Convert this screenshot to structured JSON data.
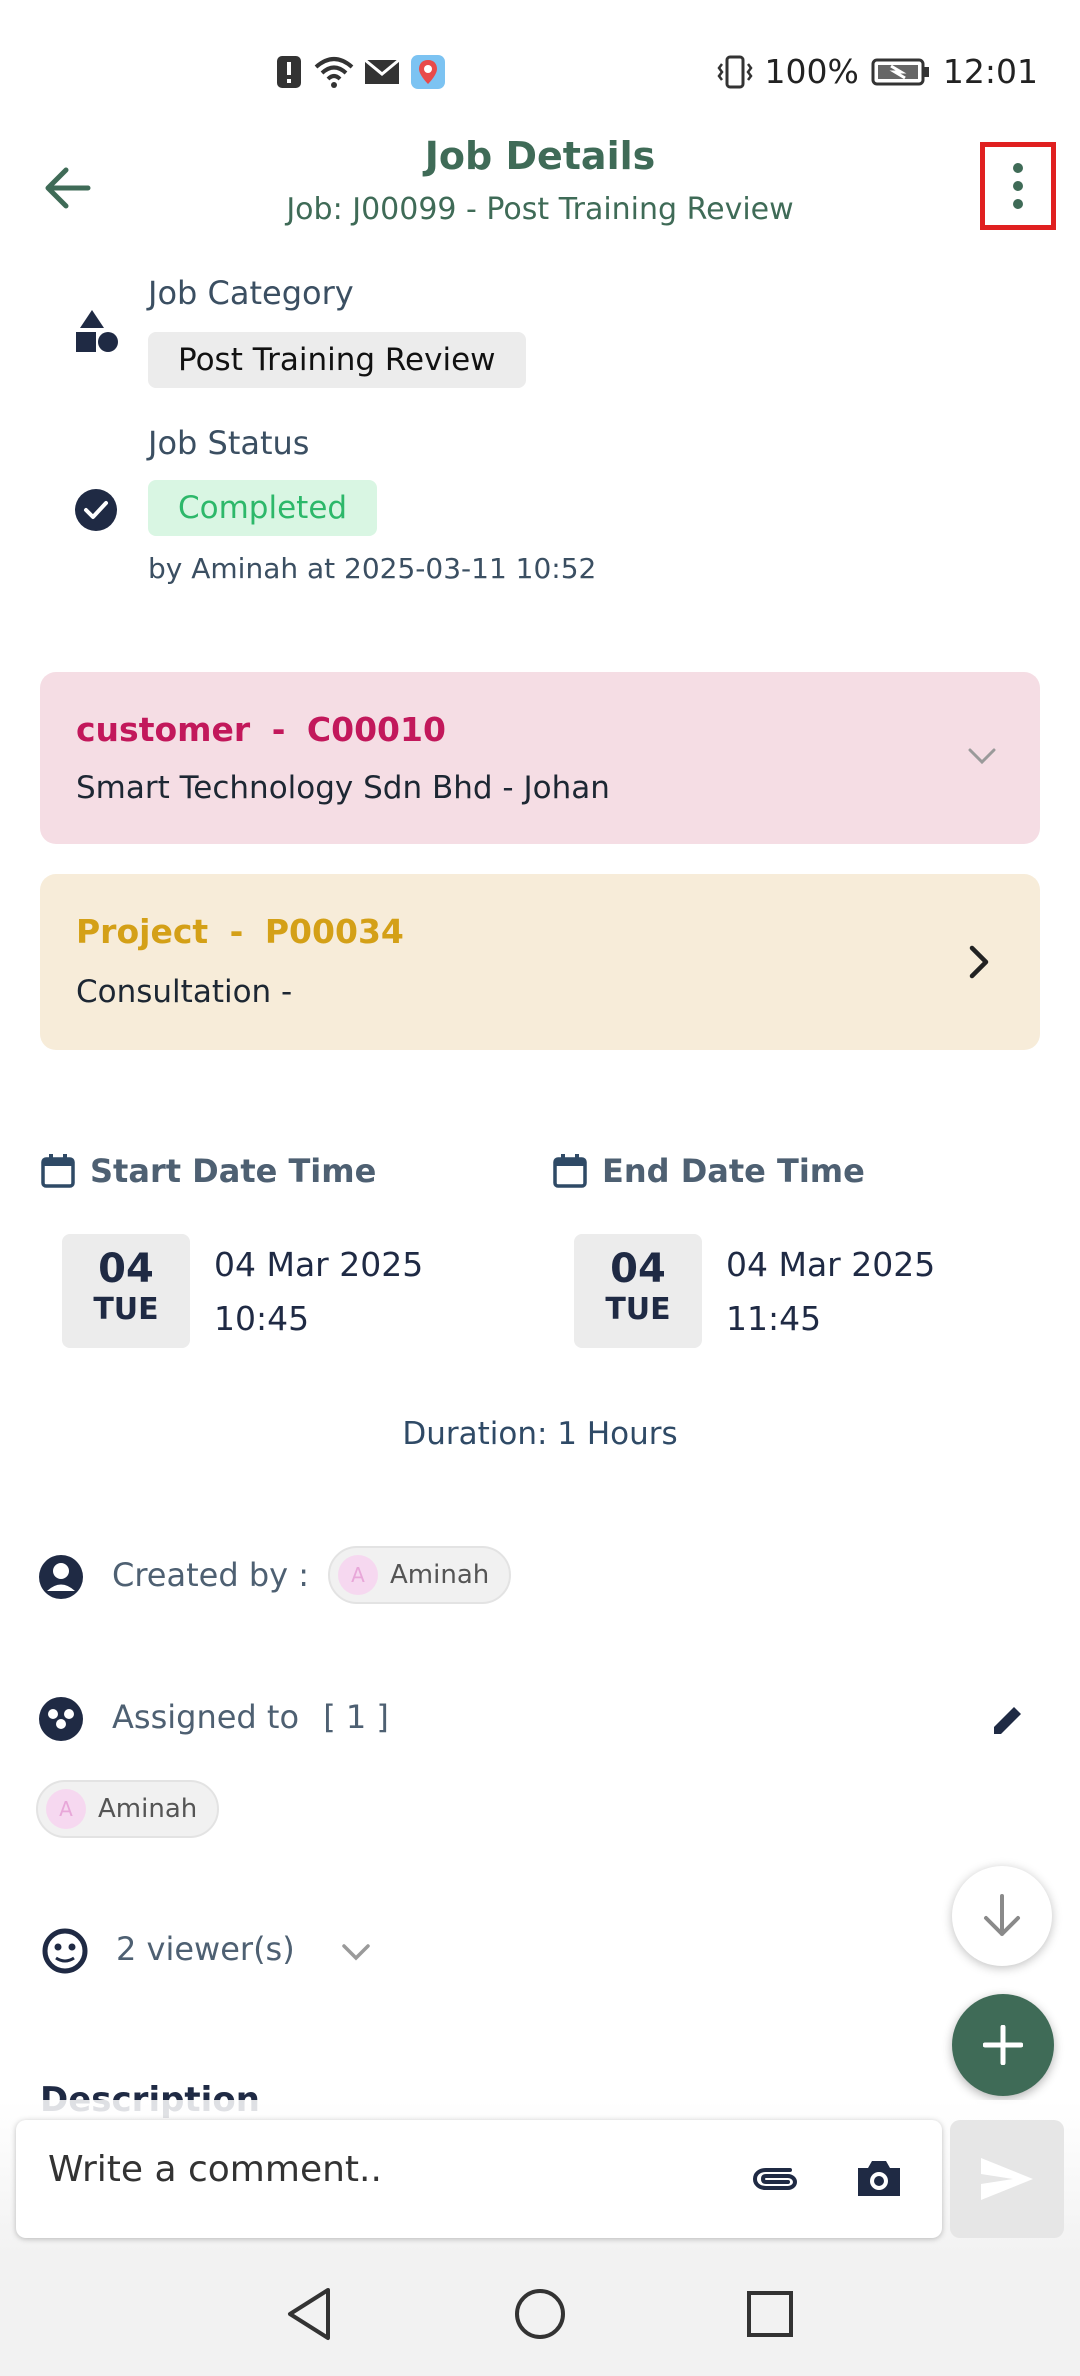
{
  "status_bar": {
    "battery_percent": "100%",
    "time": "12:01"
  },
  "header": {
    "title": "Job Details",
    "subtitle": "Job: J00099 - Post Training Review"
  },
  "job_category": {
    "label": "Job Category",
    "value": "Post Training Review"
  },
  "job_status": {
    "label": "Job Status",
    "value": "Completed",
    "by_line": "by Aminah at 2025-03-11 10:52"
  },
  "customer_card": {
    "type_label": "customer",
    "separator": "-",
    "code": "C00010",
    "detail": "Smart Technology Sdn Bhd - Johan"
  },
  "project_card": {
    "type_label": "Project",
    "separator": "-",
    "code": "P00034",
    "detail": "Consultation -"
  },
  "start": {
    "label": "Start Date Time",
    "day": "04",
    "weekday": "TUE",
    "date": "04 Mar 2025",
    "time": "10:45"
  },
  "end": {
    "label": "End Date Time",
    "day": "04",
    "weekday": "TUE",
    "date": "04 Mar 2025",
    "time": "11:45"
  },
  "duration": "Duration: 1 Hours",
  "created_by": {
    "label": "Created by :",
    "avatar_initial": "A",
    "name": "Aminah"
  },
  "assigned_to": {
    "label": "Assigned to",
    "count": "[ 1 ]",
    "avatar_initial": "A",
    "name": "Aminah"
  },
  "viewers": {
    "label": "2 viewer(s)"
  },
  "description": {
    "heading": "Description"
  },
  "comment": {
    "placeholder": "Write a comment.."
  },
  "colors": {
    "brand": "#3f6b57",
    "customer_title": "#c2185b",
    "project_title": "#d4a017",
    "status_green": "#2db86a",
    "highlight_border": "#e02020"
  }
}
